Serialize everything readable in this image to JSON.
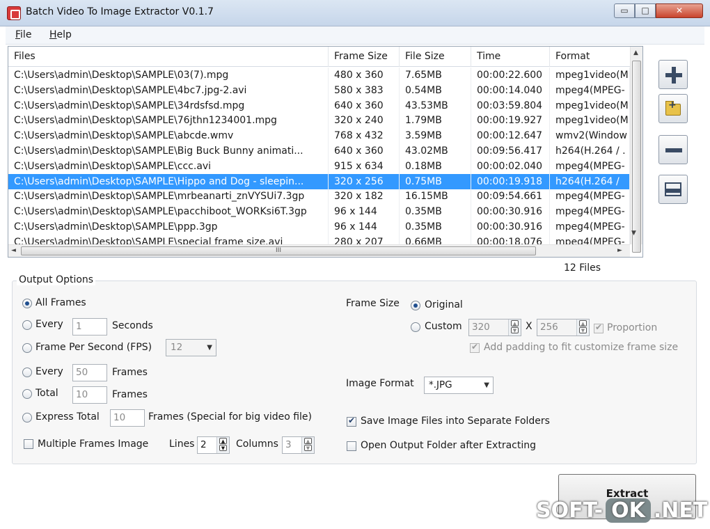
{
  "window": {
    "title": "Batch Video To Image Extractor V0.1.7",
    "min_glyph": "▭",
    "max_glyph": "□",
    "close_glyph": "✕"
  },
  "menu": [
    {
      "key": "F",
      "rest": "ile"
    },
    {
      "key": "H",
      "rest": "elp"
    }
  ],
  "list": {
    "columns": [
      "Files",
      "Frame Size",
      "File Size",
      "Time",
      "Format"
    ],
    "selected_index": 7,
    "rows": [
      [
        "C:\\Users\\admin\\Desktop\\SAMPLE\\03(7).mpg",
        "480 x 360",
        "7.65MB",
        "00:00:22.600",
        "mpeg1video(M"
      ],
      [
        "C:\\Users\\admin\\Desktop\\SAMPLE\\4bc7.jpg-2.avi",
        "580 x 383",
        "0.54MB",
        "00:00:14.040",
        "mpeg4(MPEG-"
      ],
      [
        "C:\\Users\\admin\\Desktop\\SAMPLE\\34rdsfsd.mpg",
        "640 x 360",
        "43.53MB",
        "00:03:59.804",
        "mpeg1video(M"
      ],
      [
        "C:\\Users\\admin\\Desktop\\SAMPLE\\76jthn1234001.mpg",
        "320 x 240",
        "1.79MB",
        "00:00:19.927",
        "mpeg1video(M"
      ],
      [
        "C:\\Users\\admin\\Desktop\\SAMPLE\\abcde.wmv",
        "768 x 432",
        "3.59MB",
        "00:00:12.647",
        "wmv2(Window"
      ],
      [
        "C:\\Users\\admin\\Desktop\\SAMPLE\\Big Buck Bunny animati...",
        "640 x 360",
        "43.02MB",
        "00:09:56.417",
        "h264(H.264 / ."
      ],
      [
        "C:\\Users\\admin\\Desktop\\SAMPLE\\ccc.avi",
        "915 x 634",
        "0.18MB",
        "00:00:02.040",
        "mpeg4(MPEG-"
      ],
      [
        "C:\\Users\\admin\\Desktop\\SAMPLE\\Hippo and Dog - sleepin...",
        "320 x 256",
        "0.75MB",
        "00:00:19.918",
        "h264(H.264 /"
      ],
      [
        "C:\\Users\\admin\\Desktop\\SAMPLE\\mrbeanarti_znVYSUi7.3gp",
        "320 x 182",
        "16.15MB",
        "00:09:54.661",
        "mpeg4(MPEG-"
      ],
      [
        "C:\\Users\\admin\\Desktop\\SAMPLE\\pacchiboot_WORKsi6T.3gp",
        "96 x 144",
        "0.35MB",
        "00:00:30.916",
        "mpeg4(MPEG-"
      ],
      [
        "C:\\Users\\admin\\Desktop\\SAMPLE\\ppp.3gp",
        "96 x 144",
        "0.35MB",
        "00:00:30.916",
        "mpeg4(MPEG-"
      ],
      [
        "C:\\Users\\admin\\Desktop\\SAMPLE\\special frame size.avi",
        "280 x 207",
        "0.66MB",
        "00:00:18.076",
        "mpeg4(MPEG-"
      ]
    ],
    "scroll_up": "▲",
    "scroll_down": "▼",
    "scroll_left": "◄",
    "scroll_right": "►",
    "grip": "III"
  },
  "side_buttons": [
    "plus-icon",
    "add-folder-icon",
    "minus-icon",
    "remove-all-icon"
  ],
  "file_count": "12 Files",
  "output": {
    "group_label": "Output Options",
    "all_frames": "All Frames",
    "every_label": "Every",
    "every_seconds_value": "1",
    "seconds": "Seconds",
    "fps_label": "Frame Per Second (FPS)",
    "fps_value": "12",
    "every_frames_value": "50",
    "frames": "Frames",
    "total_label": "Total",
    "total_value": "10",
    "express_label": "Express Total",
    "express_value": "10",
    "express_suffix": "Frames (Special for big video file)",
    "multiple_label": "Multiple Frames Image",
    "lines_label": "Lines",
    "lines_value": "2",
    "columns_label": "Columns",
    "columns_value": "3",
    "frame_size_label": "Frame Size",
    "original": "Original",
    "custom": "Custom",
    "width_value": "320",
    "x_sep": "X",
    "height_value": "256",
    "proportion": "Proportion",
    "padding": "Add padding to fit customize frame size",
    "image_format_label": "Image Format",
    "image_format_value": "*.JPG",
    "save_separate": "Save Image Files into Separate Folders",
    "open_folder": "Open Output Folder after Extracting",
    "spin_up": "▲",
    "spin_down": "▼",
    "dropdown": "▼"
  },
  "extract_label": "Extract",
  "watermark": {
    "left": "SOFT-",
    "ok": "OK",
    "right": ".NET"
  }
}
